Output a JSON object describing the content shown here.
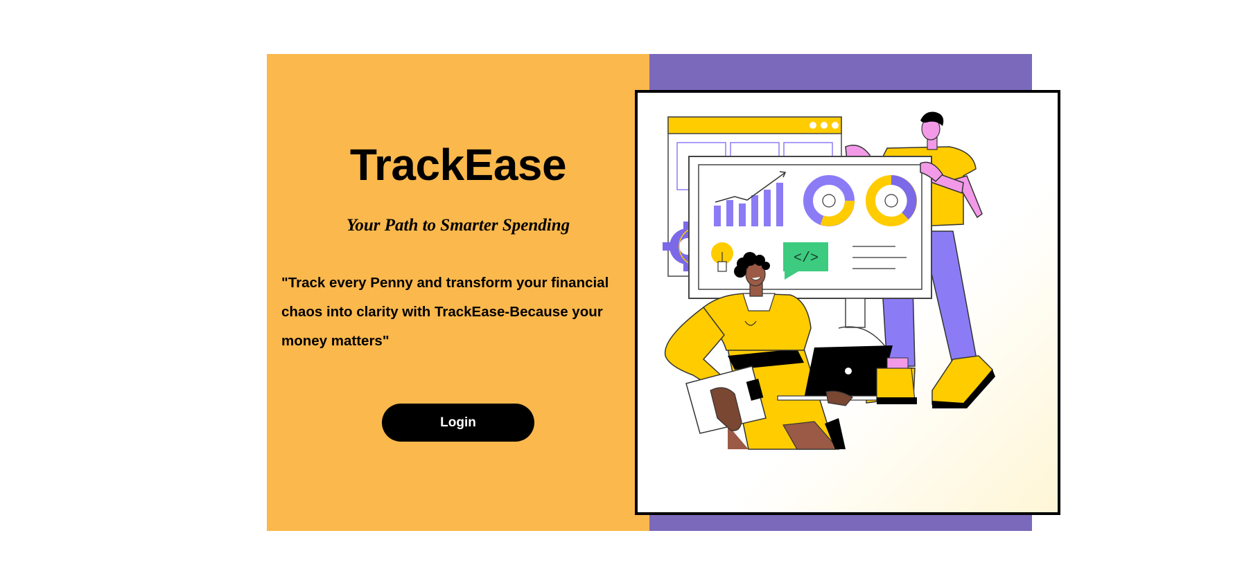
{
  "brand": {
    "title": "TrackEase",
    "tagline": "Your Path to Smarter Spending"
  },
  "hero": {
    "quote_line1": "\"Track every Penny and transform your financial",
    "quote_line2": "chaos into clarity with TrackEase-Because your",
    "quote_line3": "money matters\""
  },
  "actions": {
    "login_label": "Login"
  },
  "illustration": {
    "code_label": "</>"
  },
  "colors": {
    "left_bg": "#FBB84C",
    "right_bg": "#7B69BB",
    "accent_yellow": "#FFCC00",
    "accent_purple": "#8B7CF6",
    "button_bg": "#000000"
  }
}
